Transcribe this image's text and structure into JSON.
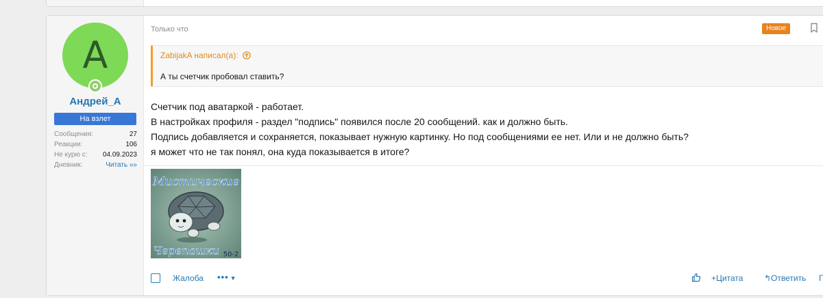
{
  "user": {
    "avatar_letter": "A",
    "name": "Андрей_A",
    "title": "На взлет",
    "stats": [
      {
        "label": "Сообщения:",
        "value": "27"
      },
      {
        "label": "Реакции:",
        "value": "106"
      },
      {
        "label": "Не курю с:",
        "value": "04.09.2023"
      },
      {
        "label": "Дневник:",
        "value": "Читать »»"
      }
    ]
  },
  "post": {
    "timestamp": "Только что",
    "badge": "Новое",
    "quote": {
      "author": "ZabijakA написал(а):",
      "text": "А ты счетчик пробовал ставить?"
    },
    "body_lines": [
      "Счетчик под аватаркой - работает.",
      "В настройках профиля - раздел \"подпись\" появился после 20 сообщений. как и должно быть.",
      "Подпись добавляется и сохраняется, показывает нужную картинку. Но под сообщениями ее нет. Или и не должно быть?",
      "я может что не так понял, она куда показывается в итоге?"
    ],
    "signature": {
      "top_text": "Мистические",
      "bottom_text": "Черепашки",
      "number": "50-2"
    }
  },
  "actions": {
    "report": "Жалоба",
    "more": "•••",
    "quote": "+Цитата",
    "reply": "↰Ответить",
    "extra": "Г"
  },
  "colors": {
    "avatar_bg": "#7ed957",
    "link": "#2577b1",
    "badge": "#e8821d",
    "quote_border": "#f29c2b",
    "usertitle_bg": "#3877d6"
  }
}
